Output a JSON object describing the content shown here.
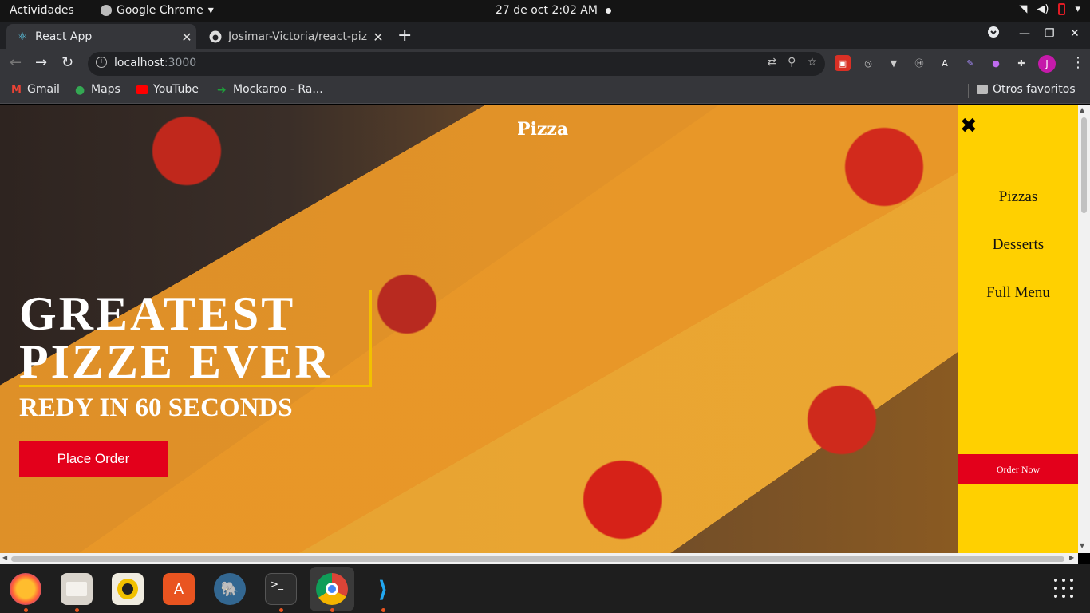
{
  "system": {
    "activities": "Actividades",
    "app_name": "Google Chrome",
    "clock": "27 de oct  2:02 AM"
  },
  "tabs": [
    {
      "title": "React App",
      "favicon": "react-icon"
    },
    {
      "title": "Josimar-Victoria/react-piz",
      "favicon": "github-icon"
    }
  ],
  "address_bar": {
    "host": "localhost",
    "port": ":3000"
  },
  "profile_initial": "J",
  "bookmarks": [
    {
      "label": "Gmail",
      "icon": "gmail-icon",
      "color": "#ea4335"
    },
    {
      "label": "Maps",
      "icon": "maps-icon",
      "color": "#34a853"
    },
    {
      "label": "YouTube",
      "icon": "youtube-icon",
      "color": "#ff0000"
    },
    {
      "label": "Mockaroo - Ra...",
      "icon": "mockaroo-icon",
      "color": "#1e9e3a"
    }
  ],
  "other_bookmarks": "Otros favoritos",
  "page": {
    "logo": "Pizza",
    "headline_line1": "GREATEST",
    "headline_line2": "PIZZE EVER",
    "subheadline": "REDY IN 60 SECONDS",
    "cta_label": "Place Order",
    "menu": [
      "Pizzas",
      "Desserts",
      "Full Menu"
    ],
    "order_now": "Order Now"
  },
  "colors": {
    "sidebar_bg": "#ffd000",
    "cta_red": "#e3001b",
    "accent_yellow": "#f2c100",
    "chrome_dark": "#202124"
  },
  "dock": [
    "firefox-icon",
    "files-icon",
    "rhythmbox-icon",
    "software-icon",
    "postgres-icon",
    "terminal-icon",
    "chrome-icon",
    "vscode-icon"
  ]
}
